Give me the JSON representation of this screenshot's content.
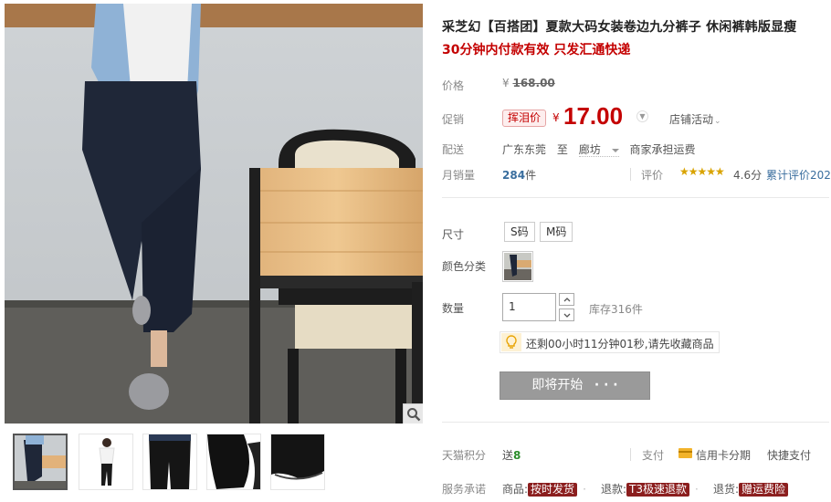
{
  "gallery": {
    "zoom_icon": "magnifier-icon",
    "thumbnails": [
      "thumb-1",
      "thumb-2",
      "thumb-3",
      "thumb-4",
      "thumb-5"
    ]
  },
  "product": {
    "title": "采芝幻【百搭团】夏款大码女装卷边九分裤子 休闲裤韩版显瘦",
    "subtitle": "30分钟内付款有效 只发汇通快递"
  },
  "price": {
    "label": "价格",
    "currency": "¥",
    "original": "168.00"
  },
  "promo": {
    "label": "促销",
    "tag": "挥泪价",
    "currency": "¥",
    "price": "17.00",
    "shop_activity": "店铺活动"
  },
  "shipping": {
    "label": "配送",
    "from": "广东东莞",
    "to_word": "至",
    "destination": "廊坊",
    "fee_note": "商家承担运费"
  },
  "sales": {
    "label": "月销量",
    "count": "284",
    "unit": "件",
    "rating_label": "评价",
    "stars": "★★★★★",
    "score": "4.6分",
    "reviews_label": "累计评价202"
  },
  "options": {
    "size_label": "尺寸",
    "sizes": [
      "S码",
      "M码"
    ],
    "color_label": "颜色分类"
  },
  "quantity": {
    "label": "数量",
    "value": "1",
    "stock": "库存316件"
  },
  "notice": {
    "text": "还剩00小时11分钟01秒,请先收藏商品",
    "icon": "lightbulb-icon"
  },
  "buy": {
    "start_label": "即将开始",
    "dots": "· · ·"
  },
  "footer": {
    "points_label": "天猫积分",
    "points_prefix": "送",
    "points_value": "8",
    "pay_label": "支付",
    "installment": "信用卡分期",
    "quickpay": "快捷支付",
    "promise_label": "服务承诺",
    "promises": [
      {
        "prefix": "商品:",
        "tag": "按时发货"
      },
      {
        "prefix": "退款:",
        "tag": "T3极速退款"
      },
      {
        "prefix": "退货:",
        "tag": "赠运费险"
      }
    ]
  },
  "colors": {
    "accent_red": "#c40000",
    "link_blue": "#3a6e9e",
    "button_gray": "#9a9a9a",
    "tag_dark_red": "#8b1e1e"
  }
}
